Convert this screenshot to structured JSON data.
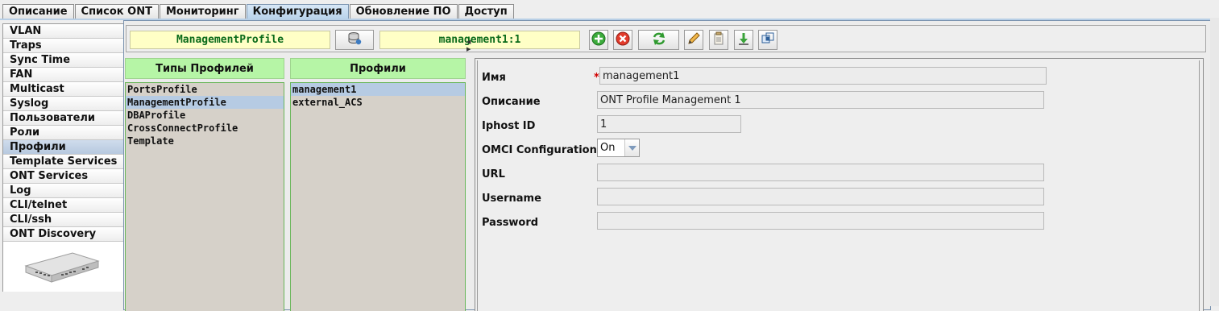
{
  "tabs": [
    "Описание",
    "Список ONT",
    "Мониторинг",
    "Конфигурация",
    "Обновление ПО",
    "Доступ"
  ],
  "active_tab": "Конфигурация",
  "nav": [
    "VLAN",
    "Traps",
    "Sync Time",
    "FAN",
    "Multicast",
    "Syslog",
    "Пользователи",
    "Роли",
    "Профили",
    "Template Services",
    "ONT Services",
    "Log",
    "CLI/telnet",
    "CLI/ssh",
    "ONT Discovery"
  ],
  "active_nav": "Профили",
  "toolbar": {
    "profile_type": "ManagementProfile",
    "profile_name": "management1:1",
    "icons": [
      "database-icon",
      "add-icon",
      "delete-icon",
      "refresh-icon",
      "edit-icon",
      "copy-icon",
      "download-icon",
      "link-icon"
    ]
  },
  "types_panel": {
    "title": "Типы Профилей",
    "items": [
      "PortsProfile",
      "ManagementProfile",
      "DBAProfile",
      "CrossConnectProfile",
      "Template"
    ],
    "selected": "ManagementProfile"
  },
  "profiles_panel": {
    "title": "Профили",
    "items": [
      "management1",
      "external_ACS"
    ],
    "selected": "management1"
  },
  "form": {
    "name_label": "Имя",
    "required_mark": "*",
    "name_value": "management1",
    "desc_label": "Описание",
    "desc_value": "ONT Profile Management 1",
    "iphost_label": "Iphost ID",
    "iphost_value": "1",
    "omci_label": "OMCI Configuration",
    "omci_value": "On",
    "url_label": "URL",
    "url_value": "",
    "username_label": "Username",
    "username_value": "",
    "password_label": "Password",
    "password_value": ""
  },
  "colors": {
    "panel_header": "#b6f5a6",
    "list_bg": "#d6d1c9",
    "selection": "#b6cbe3",
    "toolbar_field": "#ffffc6",
    "toolbar_text": "#0b6b1a"
  }
}
